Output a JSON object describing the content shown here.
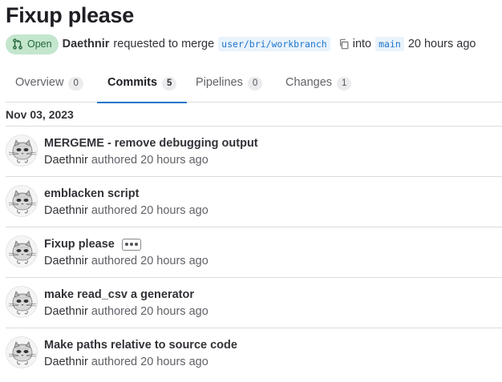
{
  "merge_request": {
    "title": "Fixup please",
    "status": "Open",
    "author": "Daethnir",
    "action_text": "requested to merge",
    "source_branch": "user/bri/workbranch",
    "into_text": "into",
    "target_branch": "main",
    "time_ago": "20 hours ago"
  },
  "tabs": [
    {
      "label": "Overview",
      "count": "0",
      "active": false
    },
    {
      "label": "Commits",
      "count": "5",
      "active": true
    },
    {
      "label": "Pipelines",
      "count": "0",
      "active": false
    },
    {
      "label": "Changes",
      "count": "1",
      "active": false
    }
  ],
  "commit_date": "Nov 03, 2023",
  "commits": [
    {
      "title": "MERGEME - remove debugging output",
      "author": "Daethnir",
      "authored_text": "authored",
      "time": "20 hours ago"
    },
    {
      "title": "emblacken script",
      "author": "Daethnir",
      "authored_text": "authored",
      "time": "20 hours ago"
    },
    {
      "title": "Fixup please",
      "author": "Daethnir",
      "authored_text": "authored",
      "time": "20 hours ago"
    },
    {
      "title": "make read_csv a generator",
      "author": "Daethnir",
      "authored_text": "authored",
      "time": "20 hours ago"
    },
    {
      "title": "Make paths relative to source code",
      "author": "Daethnir",
      "authored_text": "authored",
      "time": "20 hours ago"
    }
  ],
  "icons": {
    "status": "merge-request-icon",
    "copy": "copy-icon",
    "expand": "ellipsis-icon",
    "avatar": "cat-avatar"
  },
  "colors": {
    "accent": "#1f75cb",
    "open_badge_bg": "#c3e6cd",
    "open_badge_text": "#24663b"
  }
}
